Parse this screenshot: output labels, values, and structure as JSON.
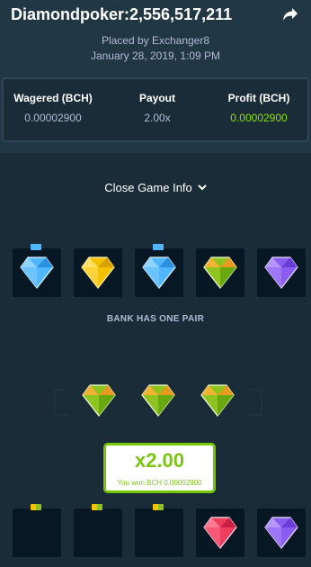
{
  "header": {
    "title": "Diamondpoker:2,556,517,211",
    "placed_by": "Placed by Exchanger8",
    "date": "January 28, 2019, 1:09 PM"
  },
  "stats": {
    "wagered_label": "Wagered (BCH)",
    "wagered_value": "0.00002900",
    "payout_label": "Payout",
    "payout_value": "2.00x",
    "profit_label": "Profit (BCH)",
    "profit_value": "0.00002900"
  },
  "game_info_toggle": "Close Game Info",
  "dealer": {
    "gems": [
      "blue",
      "yellow",
      "blue",
      "green",
      "purple"
    ],
    "result_text": "BANK HAS ONE PAIR"
  },
  "middle_gems": [
    "green",
    "green",
    "green"
  ],
  "win": {
    "multiplier": "x2.00",
    "text": "You won BCH 0.00002900"
  },
  "player": {
    "gems": [
      "empty",
      "empty",
      "empty",
      "red",
      "purple"
    ]
  },
  "colors": {
    "background": "#1a2c38",
    "panel": "#213743",
    "profit_green": "#8ee000",
    "win_border": "#75c800"
  }
}
